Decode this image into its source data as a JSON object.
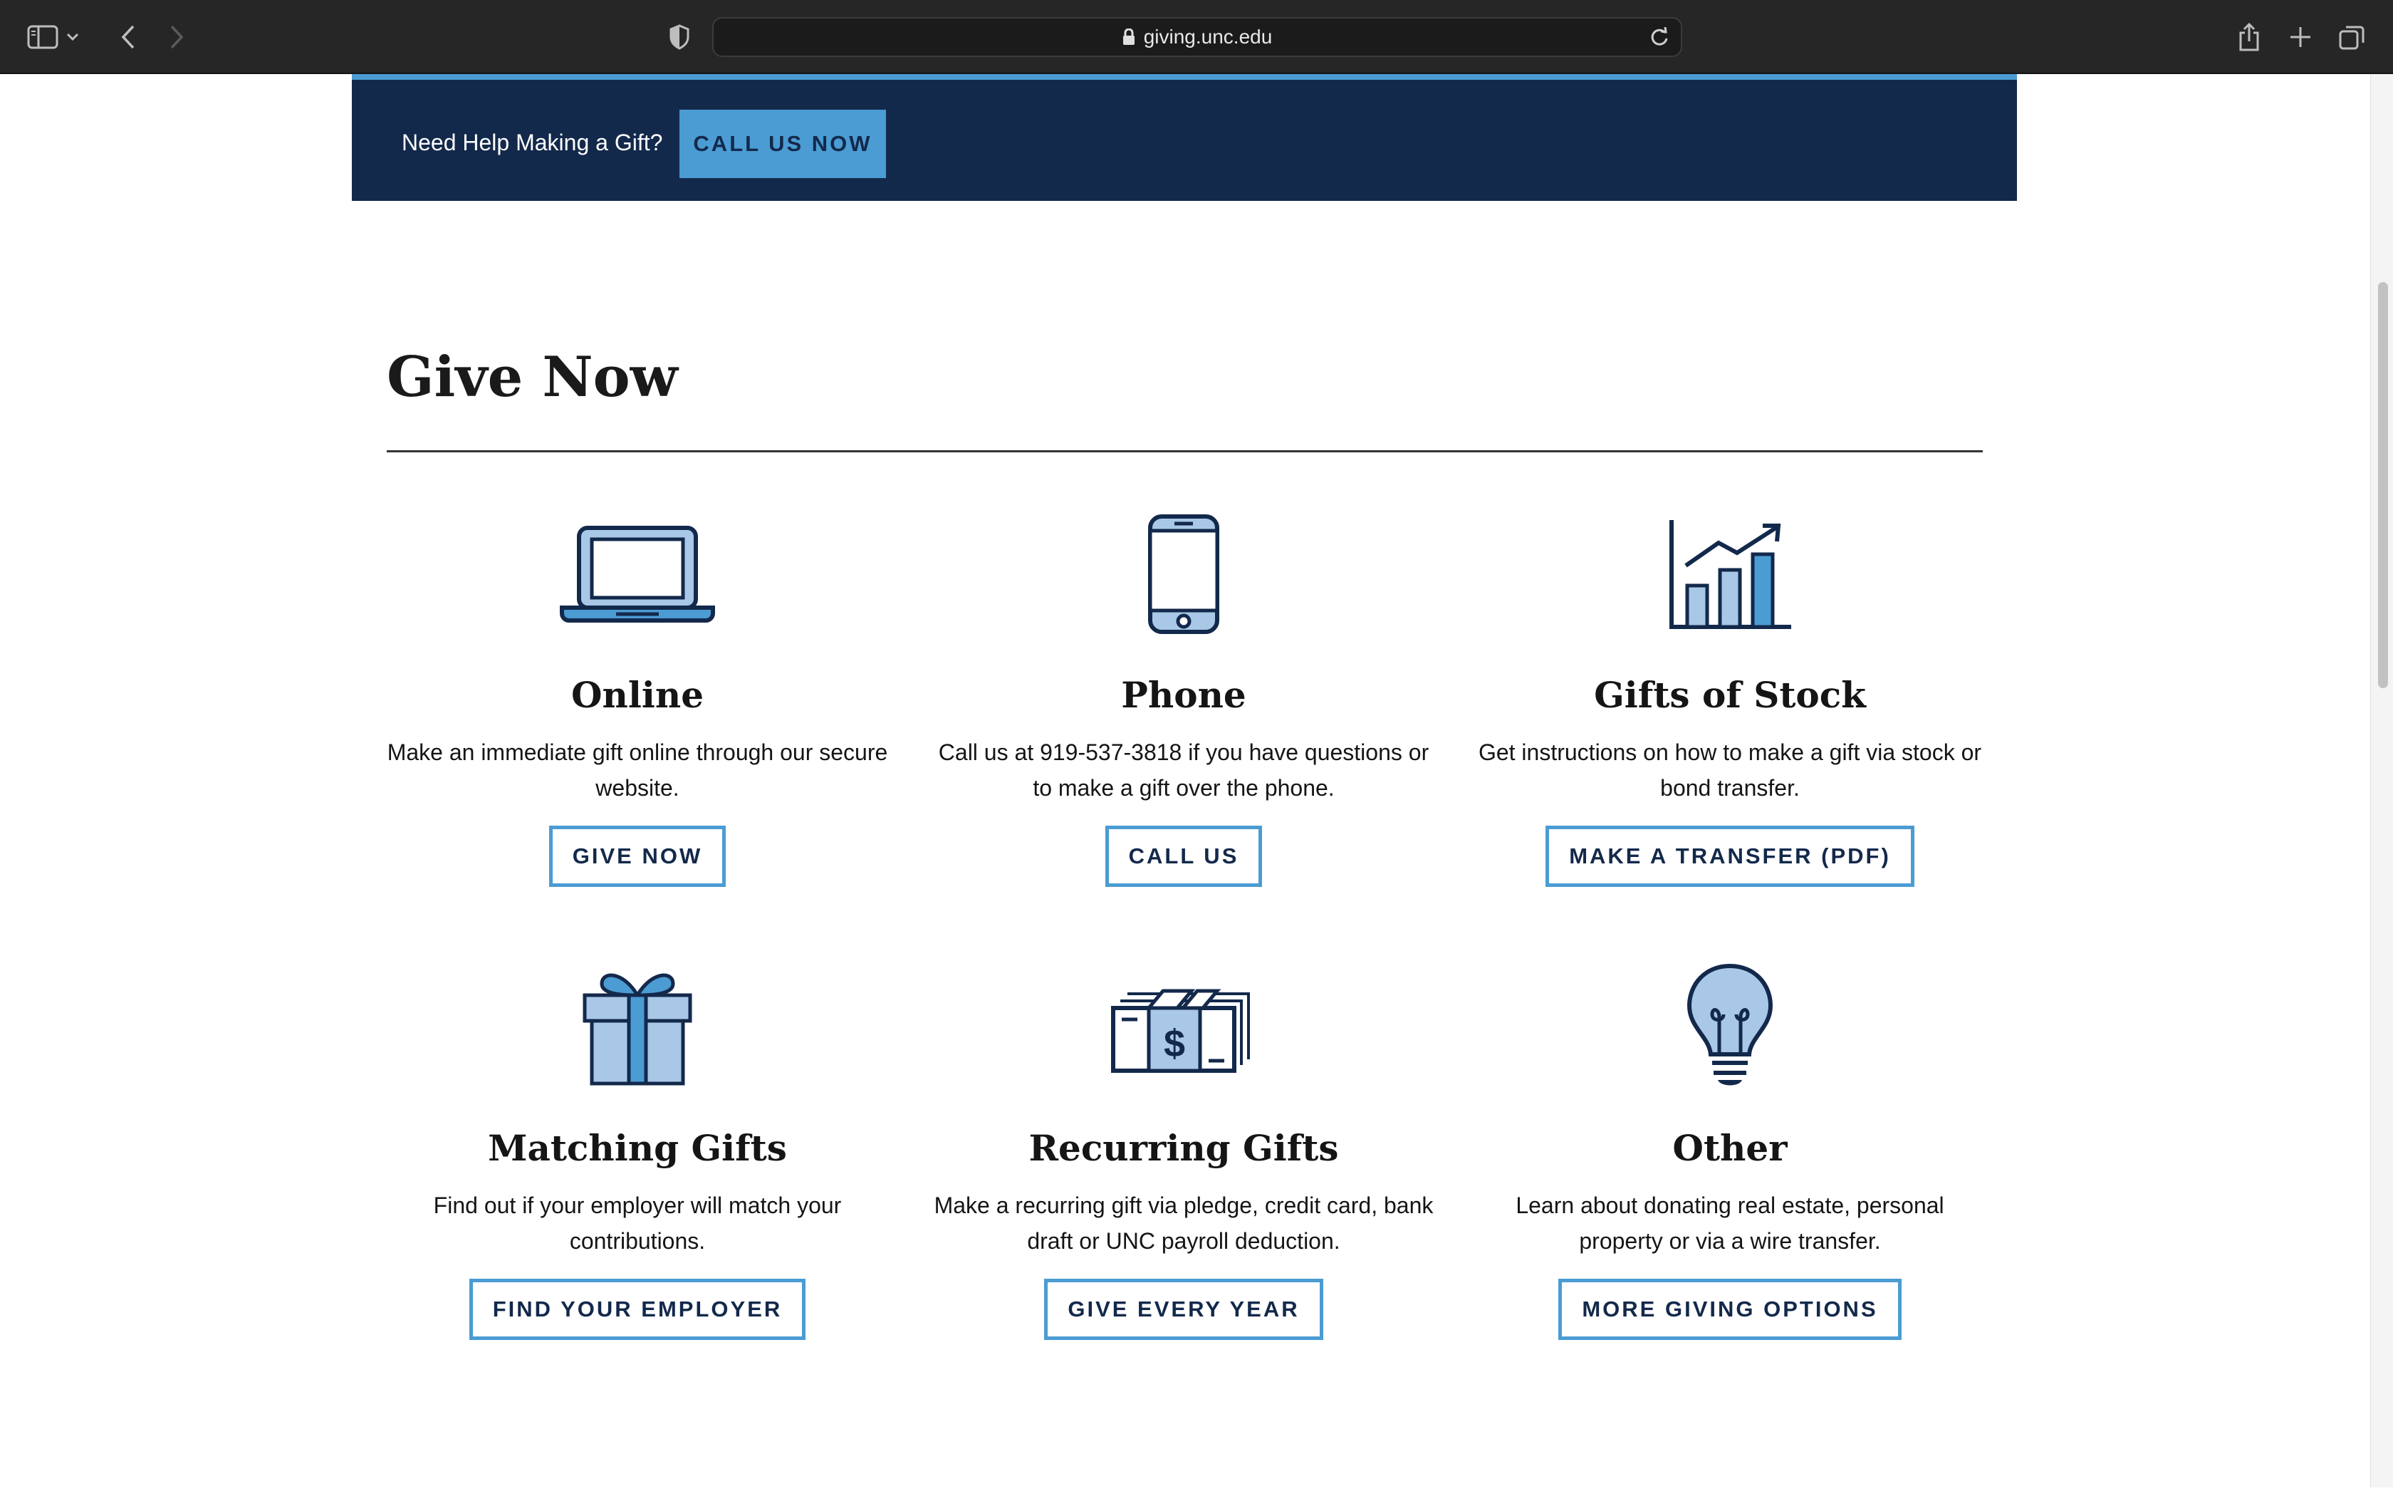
{
  "browser": {
    "url": "giving.unc.edu"
  },
  "banner": {
    "text": "Need Help Making a Gift?",
    "button": "CALL US NOW"
  },
  "section": {
    "title": "Give Now"
  },
  "cards": [
    {
      "icon": "laptop-icon",
      "title": "Online",
      "desc": "Make an immediate gift online through our secure website.",
      "button": "GIVE NOW"
    },
    {
      "icon": "phone-icon",
      "title": "Phone",
      "desc": "Call us at 919-537-3818 if you have questions or to make a gift over the phone.",
      "button": "CALL US"
    },
    {
      "icon": "chart-icon",
      "title": "Gifts of Stock",
      "desc": "Get instructions on how to make a gift via stock or bond transfer.",
      "button": "MAKE A TRANSFER (PDF)"
    },
    {
      "icon": "gift-icon",
      "title": "Matching Gifts",
      "desc": "Find out if your employer will match your contributions.",
      "button": "FIND YOUR EMPLOYER"
    },
    {
      "icon": "money-icon",
      "title": "Recurring Gifts",
      "desc": "Make a recurring gift via pledge, credit card, bank draft or UNC payroll deduction.",
      "button": "GIVE EVERY YEAR"
    },
    {
      "icon": "lightbulb-icon",
      "title": "Other",
      "desc": "Learn about donating real estate, personal property or via a wire transfer.",
      "button": "MORE GIVING OPTIONS"
    }
  ],
  "colors": {
    "navy": "#13294b",
    "carolina_blue": "#4b9cd3",
    "light_blue": "#a9c8e8"
  }
}
